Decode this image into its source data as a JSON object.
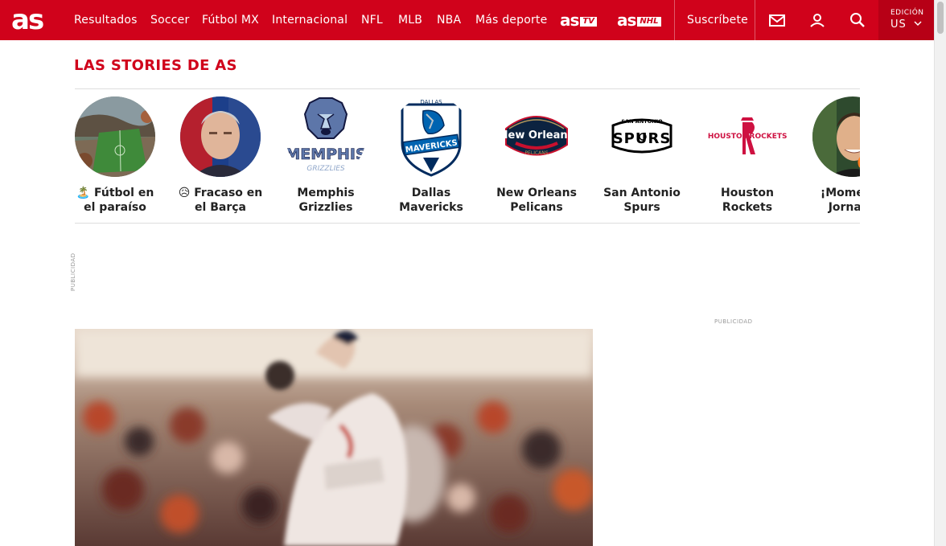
{
  "header": {
    "logo_text": "as",
    "nav": [
      "Resultados",
      "Soccer",
      "Fútbol MX",
      "Internacional",
      "NFL",
      "MLB",
      "NBA",
      "Más deporte"
    ],
    "astv": {
      "brand": "as",
      "tag": "TV"
    },
    "asnhl": {
      "brand": "as",
      "tag": "NHL"
    },
    "subscribe": "Suscríbete",
    "edition_label": "EDICIÓN",
    "edition_value": "US",
    "brand_color": "#d0021b"
  },
  "stories": {
    "title": "LAS STORIES DE AS",
    "items": [
      {
        "label": "🏝️ Fútbol en el paraíso",
        "icon": "football-field-photo"
      },
      {
        "label": "😥 Fracaso en el Barça",
        "icon": "man-portrait-photo"
      },
      {
        "label": "Memphis Grizzlies",
        "icon": "memphis-grizzlies-logo"
      },
      {
        "label": "Dallas Mavericks",
        "icon": "dallas-mavericks-logo"
      },
      {
        "label": "New Orleans Pelicans",
        "icon": "new-orleans-pelicans-logo"
      },
      {
        "label": "San Antonio Spurs",
        "icon": "san-antonio-spurs-logo"
      },
      {
        "label": "Houston Rockets",
        "icon": "houston-rockets-logo"
      },
      {
        "label": "¡Momento Jornada",
        "icon": "player-portrait-photo"
      }
    ]
  },
  "ads": {
    "left_label": "PUBLICIDAD",
    "right_label": "PUBLICIDAD"
  },
  "hero": {
    "icon": "baseball-pitcher-photo"
  }
}
